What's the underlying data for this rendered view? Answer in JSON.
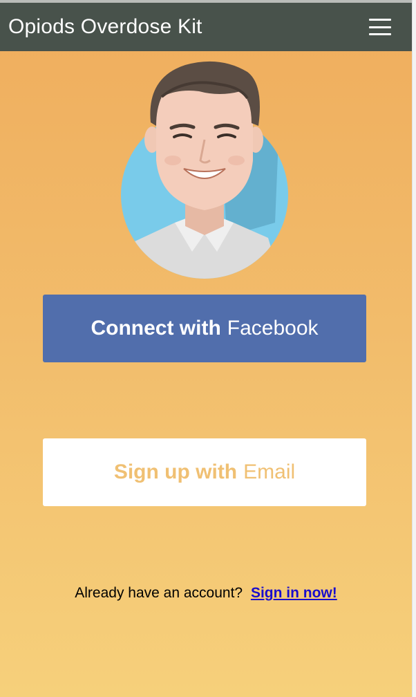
{
  "app": {
    "title": "Opiods Overdose Kit"
  },
  "navbar": {
    "menu_icon": "hamburger-menu-icon"
  },
  "avatar": {
    "icon": "user-avatar-illustration"
  },
  "facebook_button": {
    "bold": "Connect with",
    "light": "Facebook"
  },
  "email_button": {
    "bold": "Sign up with",
    "light": "Email"
  },
  "signin": {
    "prompt": "Already have an account?",
    "link": "Sign in now!"
  },
  "colors": {
    "navbar": "#48524b",
    "facebook": "#516eac",
    "email_text": "#f0c073",
    "background_top": "#efad5d",
    "background_bottom": "#f6d07b",
    "link": "#1a0dcc"
  }
}
